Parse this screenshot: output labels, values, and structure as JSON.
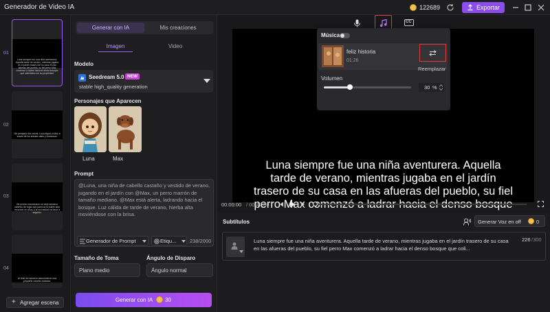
{
  "app": {
    "title": "Generador de Video IA",
    "credits": "122689",
    "export_label": "Exportar"
  },
  "scenes": {
    "items": [
      {
        "num": "01",
        "caption": "Luna siempre fue una niña aventurera. Aquella tarde de verano, mientras jugaba en el jardín trasero de su casa en las afueras del pueblo, su fiel perro Max comenzó a ladrar hacia el denso bosque que colindaba con su propiedad."
      },
      {
        "num": "02",
        "caption": "Sin pensarlo dos veces, Luna siguió a Max a través de los árboles altos y frondosos."
      },
      {
        "num": "03",
        "caption": "De pronto encontraron un viejo sendero cubierto de hojas que parecía no haber sido recorrido en años, y la curiosidad los llevó a seguirlo."
      },
      {
        "num": "04",
        "caption": "Al final del sendero descubrieron una pequeña cabaña olvidada."
      }
    ],
    "add_label": "Agregar escena"
  },
  "panel": {
    "tab_generate": "Generar con IA",
    "tab_creations": "Mis creaciones",
    "sub_image": "Imagen",
    "sub_video": "Video",
    "model_label": "Modelo",
    "model_name": "Seedream 5.0",
    "model_badge": "NEW",
    "model_desc": "stable high_quality generation",
    "characters_label": "Personajes que Aparecen",
    "characters": [
      {
        "name": "Luna"
      },
      {
        "name": "Max"
      }
    ],
    "prompt_label": "Prompt",
    "prompt_text": "@Luna, una niña de cabello castaño y vestido de verano, jugando en el jardín con @Max, un perro marrón de tamaño mediano. @Max está alerta, ladrando hacia el bosque. Luz cálida de tarde de verano, hierba alta moviéndose con la brisa.",
    "prompt_generator": "Generador de Prompt",
    "tags": "Etiqu...",
    "counter": "238/2000",
    "shot_size_label": "Tamaño de Toma",
    "shot_size_value": "Plano medio",
    "angle_label": "Ángulo de Disparo",
    "angle_value": "Ángulo normal",
    "generate_label": "Generar con IA",
    "generate_cost": "30"
  },
  "music": {
    "title": "Música",
    "enabled": false,
    "track_name": "feliz historia",
    "track_duration": "01:26",
    "replace_label": "Reemplazar",
    "volume_label": "Volumen",
    "volume_value": "30",
    "volume_unit": "%",
    "volume_level": 0.3
  },
  "preview": {
    "subtitle_text": "Luna siempre fue una niña aventurera. Aquella tarde de verano, mientras jugaba en el jardín trasero de su casa en las afueras del pueblo, su fiel perro Max comenzó a ladrar hacia el denso bosque que colindaba con su propiedad.",
    "time_current": "00:00:00",
    "time_total": "/ 00:42:00"
  },
  "subtitles": {
    "title": "Subtítulos",
    "voice_button": "Generar Voz en off",
    "voice_cost": "0",
    "item_text": "Luna siempre fue una niña aventurera. Aquella tarde de verano, mientras jugaba en el jardín trasero de su casa en las afueras del pueblo, su fiel perro Max comenzó a ladrar hacia el denso bosque que coli...",
    "item_count": "226",
    "item_max": "/300"
  },
  "colors": {
    "accent": "#9b5cf6",
    "highlight": "#e03a3a",
    "background": "#161618"
  }
}
